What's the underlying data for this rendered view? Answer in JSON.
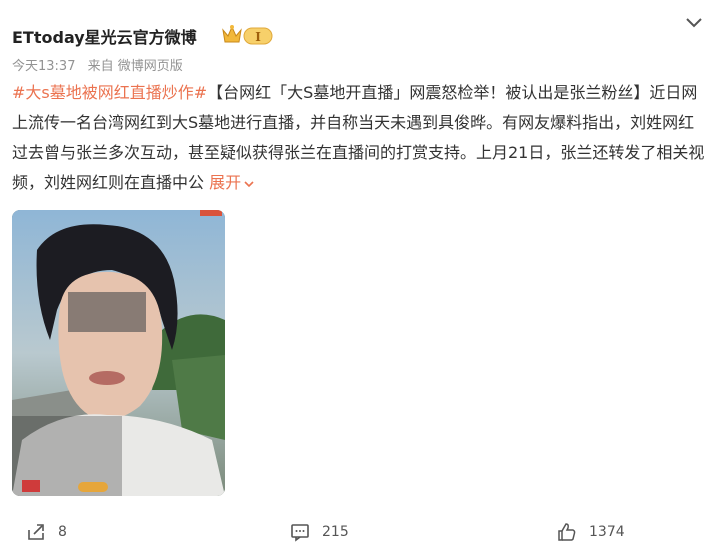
{
  "post": {
    "author": "ETtoday星光云官方微博",
    "vip_label": "I",
    "time": "今天13:37",
    "source": "来自 微博网页版",
    "topic": "#大s墓地被网红直播炒作#",
    "body": "【台网红「大S墓地开直播」网震怒检举！被认出是张兰粉丝】近日网上流传一名台湾网红到大S墓地进行直播，并自称当天未遇到具俊晔。有网友爆料指出，刘姓网红过去曾与张兰多次互动，甚至疑似获得张兰在直播间的打赏支持。上月21日，张兰还转发了相关视频，刘姓网红则在直播中公",
    "expand_label": "展开"
  },
  "actions": {
    "repost_count": "8",
    "comment_count": "215",
    "like_count": "1374"
  },
  "colors": {
    "accent": "#eb7350",
    "vip_gold": "#f2b83a"
  },
  "icons": [
    "vip-crown-icon",
    "chevron-down-icon",
    "repost-icon",
    "comment-icon",
    "like-icon"
  ]
}
